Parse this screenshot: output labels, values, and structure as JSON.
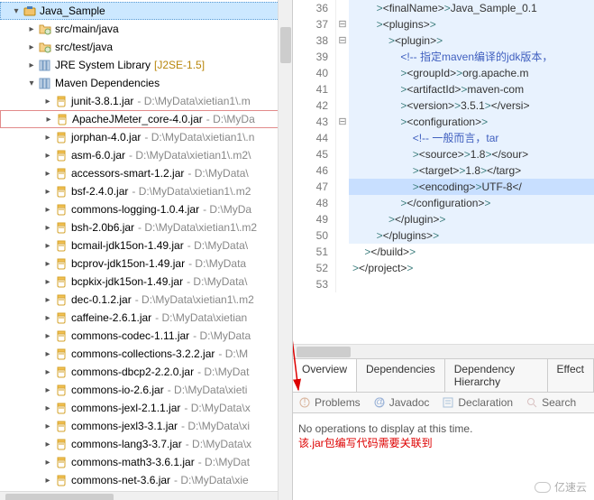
{
  "project": {
    "name": "Java_Sample",
    "folders": [
      {
        "label": "src/main/java"
      },
      {
        "label": "src/test/java"
      }
    ],
    "jre_label": "JRE System Library",
    "jre_spec": "[J2SE-1.5]",
    "maven_label": "Maven Dependencies",
    "jars": [
      {
        "name": "junit-3.8.1.jar",
        "path": "D:\\MyData\\xietian1\\.m"
      },
      {
        "name": "ApacheJMeter_core-4.0.jar",
        "path": "D:\\MyDa",
        "hl": true
      },
      {
        "name": "jorphan-4.0.jar",
        "path": "D:\\MyData\\xietian1\\.n"
      },
      {
        "name": "asm-6.0.jar",
        "path": "D:\\MyData\\xietian1\\.m2\\"
      },
      {
        "name": "accessors-smart-1.2.jar",
        "path": "D:\\MyData\\"
      },
      {
        "name": "bsf-2.4.0.jar",
        "path": "D:\\MyData\\xietian1\\.m2"
      },
      {
        "name": "commons-logging-1.0.4.jar",
        "path": "D:\\MyDa"
      },
      {
        "name": "bsh-2.0b6.jar",
        "path": "D:\\MyData\\xietian1\\.m2"
      },
      {
        "name": "bcmail-jdk15on-1.49.jar",
        "path": "D:\\MyData\\"
      },
      {
        "name": "bcprov-jdk15on-1.49.jar",
        "path": "D:\\MyData"
      },
      {
        "name": "bcpkix-jdk15on-1.49.jar",
        "path": "D:\\MyData\\"
      },
      {
        "name": "dec-0.1.2.jar",
        "path": "D:\\MyData\\xietian1\\.m2"
      },
      {
        "name": "caffeine-2.6.1.jar",
        "path": "D:\\MyData\\xietian"
      },
      {
        "name": "commons-codec-1.11.jar",
        "path": "D:\\MyData"
      },
      {
        "name": "commons-collections-3.2.2.jar",
        "path": "D:\\M"
      },
      {
        "name": "commons-dbcp2-2.2.0.jar",
        "path": "D:\\MyDat"
      },
      {
        "name": "commons-io-2.6.jar",
        "path": "D:\\MyData\\xieti"
      },
      {
        "name": "commons-jexl-2.1.1.jar",
        "path": "D:\\MyData\\x"
      },
      {
        "name": "commons-jexl3-3.1.jar",
        "path": "D:\\MyData\\xi"
      },
      {
        "name": "commons-lang3-3.7.jar",
        "path": "D:\\MyData\\x"
      },
      {
        "name": "commons-math3-3.6.1.jar",
        "path": "D:\\MyDat"
      },
      {
        "name": "commons-net-3.6.jar",
        "path": "D:\\MyData\\xie"
      }
    ]
  },
  "editor": {
    "lines": [
      {
        "n": 36,
        "indent": 8,
        "code": "<finalName>Java_Sample_0.1"
      },
      {
        "n": 37,
        "indent": 8,
        "code": "<plugins>",
        "fold": "-"
      },
      {
        "n": 38,
        "indent": 12,
        "code": "<plugin>",
        "fold": "-"
      },
      {
        "n": 39,
        "indent": 16,
        "code": "<!-- 指定maven编译的jdk版本，",
        "cls": "comment"
      },
      {
        "n": 40,
        "indent": 16,
        "code": "<groupId>org.apache.m"
      },
      {
        "n": 41,
        "indent": 16,
        "code": "<artifactId>maven-com"
      },
      {
        "n": 42,
        "indent": 16,
        "code": "<version>3.5.1</versi"
      },
      {
        "n": 43,
        "indent": 16,
        "code": "<configuration>",
        "fold": "-"
      },
      {
        "n": 44,
        "indent": 20,
        "code": "<!-- 一般而言，tar",
        "cls": "comment"
      },
      {
        "n": 45,
        "indent": 20,
        "code": "<source>1.8</sour"
      },
      {
        "n": 46,
        "indent": 20,
        "code": "<target>1.8</targ"
      },
      {
        "n": 47,
        "indent": 20,
        "code": "<encoding>UTF-8</",
        "current": true
      },
      {
        "n": 48,
        "indent": 16,
        "code": "</configuration>"
      },
      {
        "n": 49,
        "indent": 12,
        "code": "</plugin>"
      },
      {
        "n": 50,
        "indent": 8,
        "code": "</plugins>"
      },
      {
        "n": 51,
        "indent": 4,
        "code": "</build>"
      },
      {
        "n": 52,
        "indent": 0,
        "code": "</project>"
      },
      {
        "n": 53,
        "indent": 0,
        "code": ""
      }
    ]
  },
  "pom_tabs": [
    "Overview",
    "Dependencies",
    "Dependency Hierarchy",
    "Effect"
  ],
  "views": {
    "problems": "Problems",
    "javadoc": "Javadoc",
    "declaration": "Declaration",
    "search": "Search"
  },
  "console": {
    "msg": "No operations to display at this time.",
    "annot": "该.jar包编写代码需要关联到"
  },
  "watermark": "亿速云"
}
